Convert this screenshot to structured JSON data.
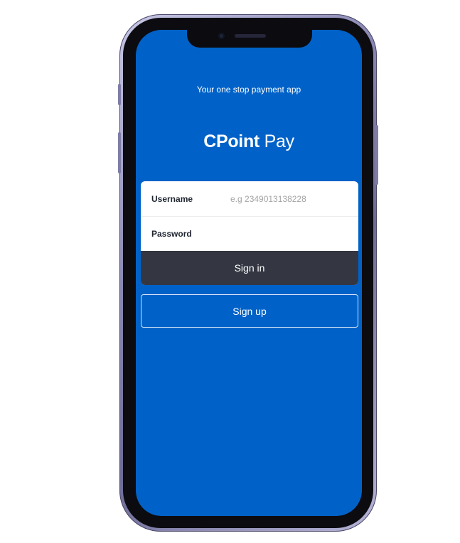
{
  "app": {
    "tagline": "Your one stop payment app",
    "brand_bold": "CPoint",
    "brand_light": "Pay"
  },
  "login_form": {
    "username_label": "Username",
    "username_placeholder": "e.g 2349013138228",
    "username_value": "",
    "password_label": "Password",
    "password_value": ""
  },
  "buttons": {
    "sign_in": "Sign in",
    "sign_up": "Sign up"
  },
  "colors": {
    "screen_background": "#0062c8",
    "sign_in_button": "#343742",
    "text_primary": "#ffffff"
  }
}
